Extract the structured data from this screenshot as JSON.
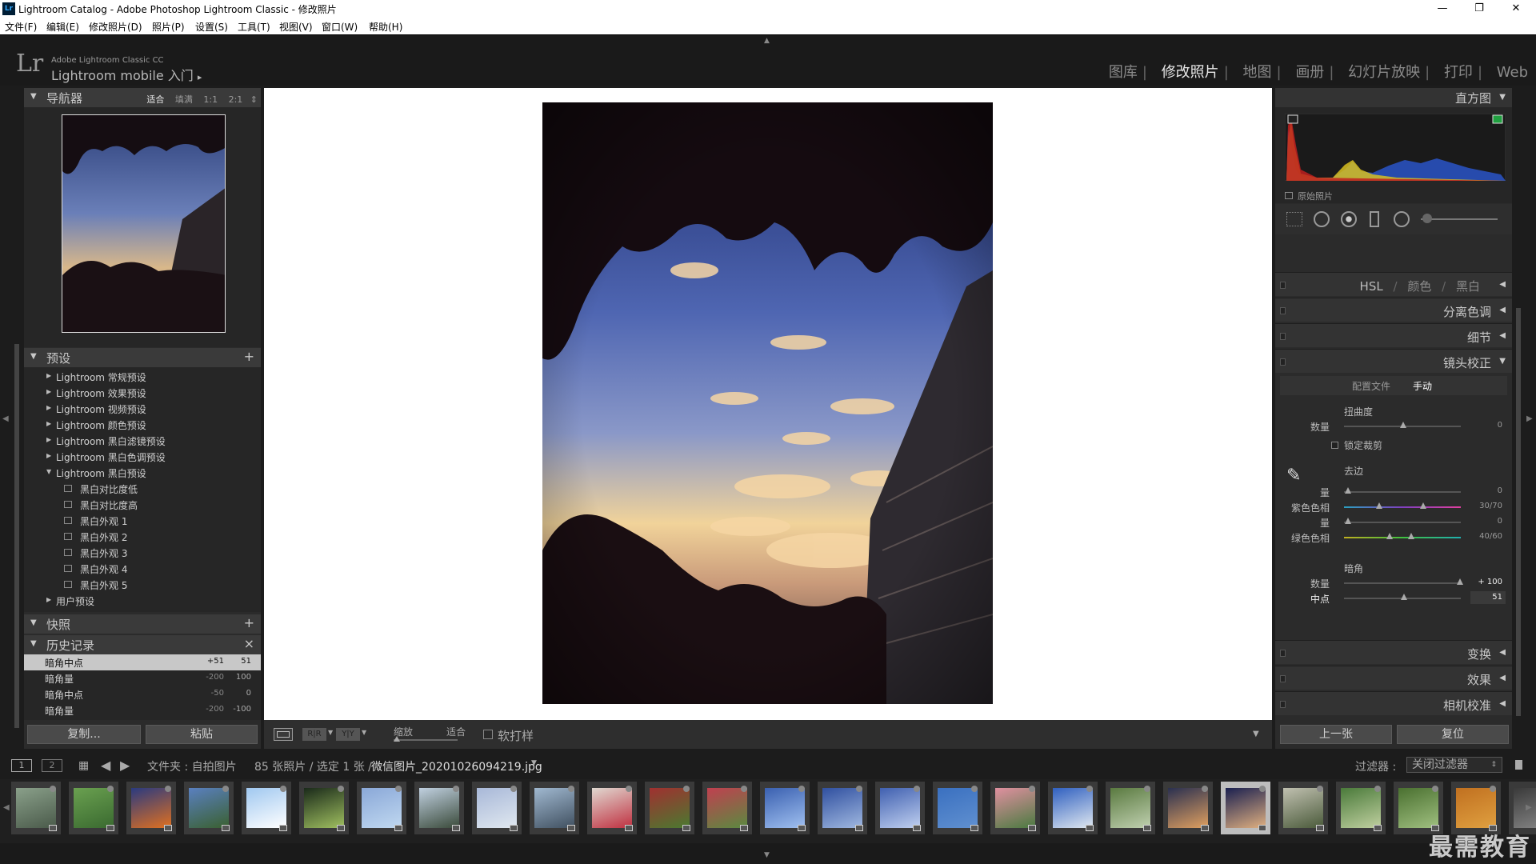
{
  "window": {
    "title": "Lightroom Catalog - Adobe Photoshop Lightroom Classic - 修改照片",
    "minimize": "—",
    "restore": "❐",
    "close": "✕"
  },
  "menu": [
    "文件(F)",
    "编辑(E)",
    "修改照片(D)",
    "照片(P)",
    "设置(S)",
    "工具(T)",
    "视图(V)",
    "窗口(W)",
    "帮助(H)"
  ],
  "brand": {
    "logo": "Lr",
    "line1": "Adobe Lightroom Classic CC",
    "line2": "Lightroom mobile 入门",
    "arrow": "▸"
  },
  "modules": [
    "图库",
    "修改照片",
    "地图",
    "画册",
    "幻灯片放映",
    "打印",
    "Web"
  ],
  "modules_active": "修改照片",
  "left": {
    "navigator": {
      "title": "导航器",
      "opts": [
        "适合",
        "填满",
        "1:1",
        "2:1"
      ]
    },
    "presets": {
      "title": "预设",
      "add": "+",
      "items": [
        {
          "label": "Lightroom 常规预设",
          "type": "folder"
        },
        {
          "label": "Lightroom 效果预设",
          "type": "folder"
        },
        {
          "label": "Lightroom 视频预设",
          "type": "folder"
        },
        {
          "label": "Lightroom 颜色预设",
          "type": "folder"
        },
        {
          "label": "Lightroom 黑白滤镜预设",
          "type": "folder"
        },
        {
          "label": "Lightroom 黑白色调预设",
          "type": "folder"
        },
        {
          "label": "Lightroom 黑白预设",
          "type": "open"
        },
        {
          "label": "黑白对比度低",
          "type": "item"
        },
        {
          "label": "黑白对比度高",
          "type": "item"
        },
        {
          "label": "黑白外观 1",
          "type": "item"
        },
        {
          "label": "黑白外观 2",
          "type": "item"
        },
        {
          "label": "黑白外观 3",
          "type": "item"
        },
        {
          "label": "黑白外观 4",
          "type": "item"
        },
        {
          "label": "黑白外观 5",
          "type": "item"
        },
        {
          "label": "用户预设",
          "type": "folder"
        }
      ]
    },
    "snapshots": {
      "title": "快照",
      "add": "+"
    },
    "history": {
      "title": "历史记录",
      "clear": "×",
      "items": [
        {
          "label": "暗角中点",
          "v1": "+51",
          "v2": "51",
          "selected": true
        },
        {
          "label": "暗角量",
          "v1": "-200",
          "v2": "100"
        },
        {
          "label": "暗角中点",
          "v1": "-50",
          "v2": "0"
        },
        {
          "label": "暗角量",
          "v1": "-200",
          "v2": "-100"
        }
      ]
    },
    "copy": "复制...",
    "paste": "粘贴"
  },
  "toolbar": {
    "zoom_label": "缩放",
    "zoom_fit": "适合",
    "softproof": "软打样"
  },
  "right": {
    "histogram": {
      "title": "直方图",
      "original": "原始照片"
    },
    "sections": {
      "hsl": "HSL",
      "color": "颜色",
      "bw": "黑白",
      "split": "分离色调",
      "detail": "细节",
      "lens": "镜头校正",
      "transform": "变换",
      "effects": "效果",
      "calibration": "相机校准"
    },
    "lens": {
      "tab_profile": "配置文件",
      "tab_manual": "手动",
      "distortion": "扭曲度",
      "amount": "数量",
      "amount_value": "0",
      "constrain": "锁定裁剪",
      "defringe": "去边",
      "purple_amount": "量",
      "purple_amount_value": "0",
      "purple_hue": "紫色色相",
      "purple_hue_value": "30/70",
      "green_amount": "量",
      "green_amount_value": "0",
      "green_hue": "绿色色相",
      "green_hue_value": "40/60",
      "vignette": "暗角",
      "vig_amount": "数量",
      "vig_amount_value": "+ 100",
      "vig_mid": "中点",
      "vig_mid_value": "51"
    },
    "prev": "上一张",
    "reset": "复位"
  },
  "filmhead": {
    "view1": "1",
    "view2": "2",
    "source": "文件夹 : 自拍图片",
    "count": "85 张照片 / 选定 1 张 /",
    "filename": "微信图片_20201026094219.jpg",
    "filter_label": "过滤器 :",
    "filter_value": "关闭过滤器"
  },
  "watermark": "最需教育"
}
